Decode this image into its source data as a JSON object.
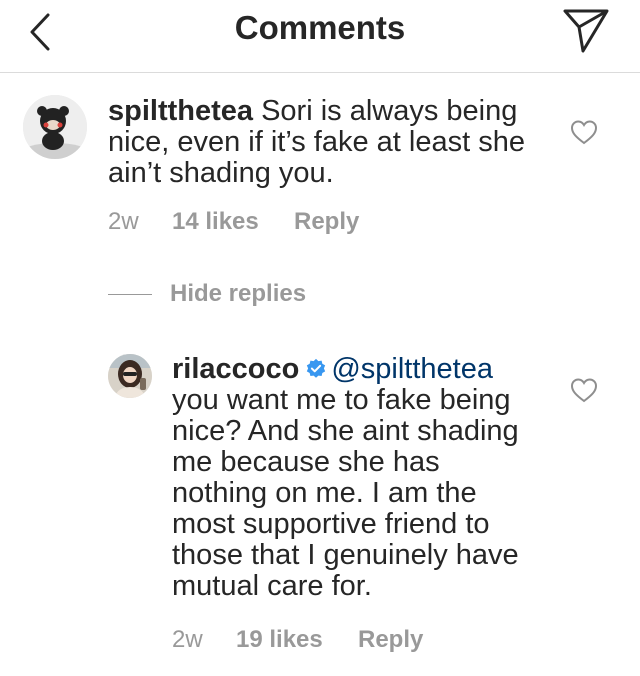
{
  "header": {
    "title": "Comments"
  },
  "comments": [
    {
      "username": "spiltthetea",
      "text": " Sori is always being nice, even if it’s fake at least she ain’t shading you.",
      "time": "2w",
      "likes": "14 likes",
      "reply_label": "Reply"
    }
  ],
  "hide_replies_label": "Hide replies",
  "replies": [
    {
      "username": "rilaccoco",
      "mention": "@spiltthetea",
      "text": "you want me to fake being nice? And she aint shading me because she has nothing on me. I am the most supportive friend to those that I genuinely have mutual care for.",
      "time": "2w",
      "likes": "19 likes",
      "reply_label": "Reply"
    }
  ],
  "colors": {
    "text": "#262626",
    "meta": "#999999",
    "verified": "#3897f0",
    "divider": "#dbdbdb"
  }
}
